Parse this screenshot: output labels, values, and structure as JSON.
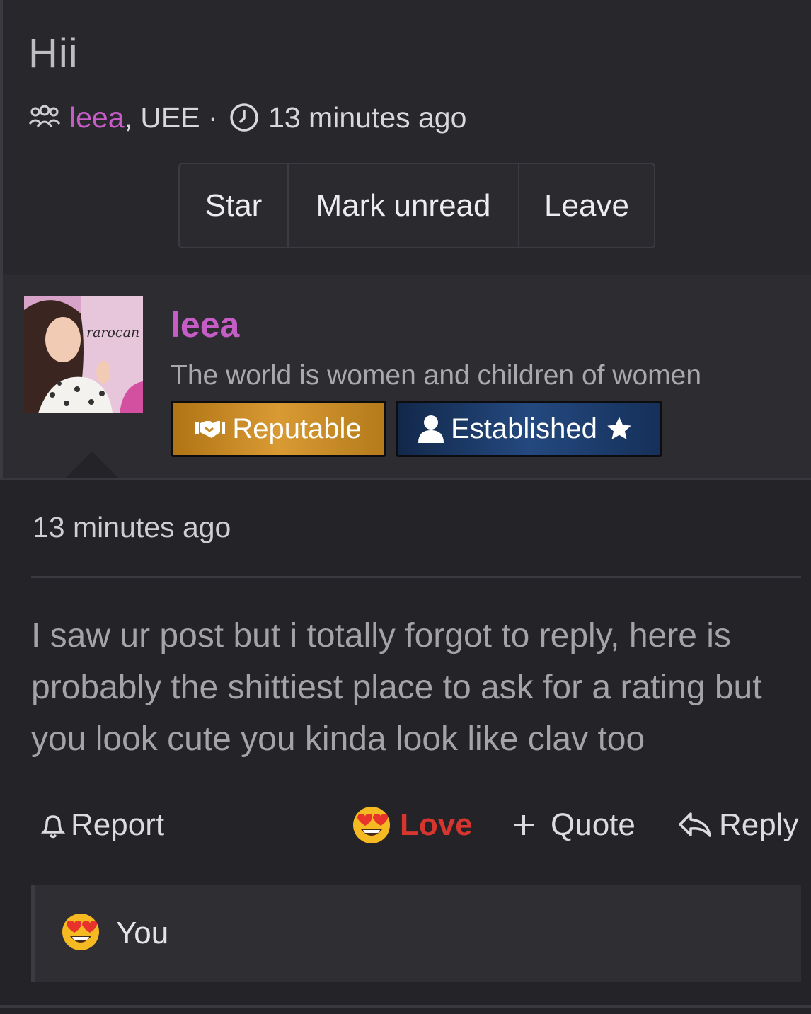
{
  "conversation": {
    "title": "Hii",
    "participants": {
      "names": [
        "leea",
        "UEE"
      ],
      "separator": ", ",
      "dot": " · "
    },
    "time": "13 minutes ago",
    "actions": [
      "Star",
      "Mark unread",
      "Leave"
    ]
  },
  "message": {
    "user": {
      "name": "leea",
      "title": "The world is women and children of women",
      "avatar_caption": "rarocan",
      "banners": [
        {
          "label": "Reputable",
          "icon": "handshake-icon"
        },
        {
          "label": "Established",
          "icon": "user-icon",
          "suffix_icon": "star-icon"
        }
      ]
    },
    "time": "13 minutes ago",
    "body": "I saw ur post but i totally forgot to reply, here is probably the shittiest place to ask for a rating but you look cute you kinda look like clav too",
    "actions": {
      "report": "Report",
      "love": "Love",
      "quote": "Quote",
      "reply": "Reply"
    },
    "reactions": {
      "emoji": "heart-eyes-emoji",
      "label": "You"
    }
  },
  "colors": {
    "accent_pink": "#c65cc6",
    "love_red": "#d7362f",
    "reputable_gold": "#d99a33",
    "established_blue": "#24497f",
    "background": "#232328"
  }
}
